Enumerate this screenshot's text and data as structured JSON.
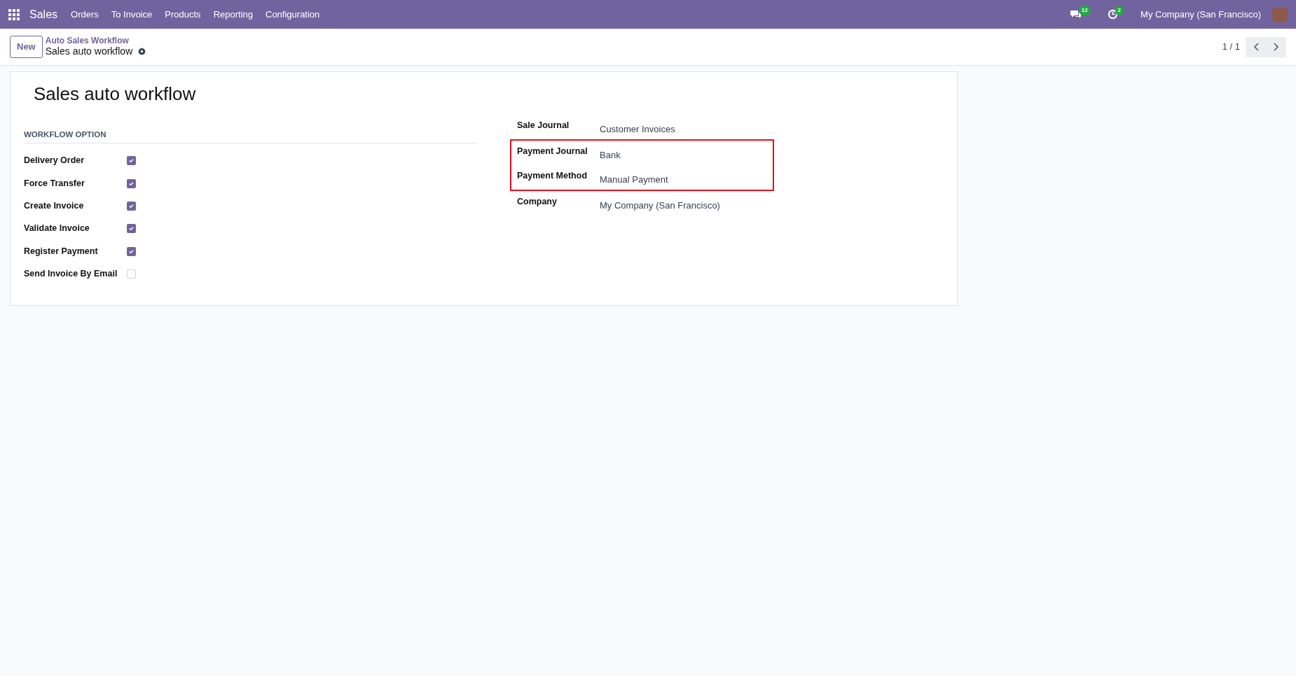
{
  "navbar": {
    "app": "Sales",
    "menu": [
      "Orders",
      "To Invoice",
      "Products",
      "Reporting",
      "Configuration"
    ],
    "messages_count": "12",
    "activities_count": "2",
    "company": "My Company (San Francisco)"
  },
  "control_panel": {
    "new_button": "New",
    "breadcrumb": "Auto Sales Workflow",
    "record": "Sales auto workflow",
    "pager": "1 / 1"
  },
  "form": {
    "title": "Sales auto workflow",
    "section": "WORKFLOW OPTION",
    "options": [
      {
        "label": "Delivery Order",
        "checked": true
      },
      {
        "label": "Force Transfer",
        "checked": true
      },
      {
        "label": "Create Invoice",
        "checked": true
      },
      {
        "label": "Validate Invoice",
        "checked": true
      },
      {
        "label": "Register Payment",
        "checked": true
      },
      {
        "label": "Send Invoice By Email",
        "checked": false
      }
    ],
    "fields": [
      {
        "label": "Sale Journal",
        "value": "Customer Invoices",
        "highlighted": false
      },
      {
        "label": "Payment Journal",
        "value": "Bank",
        "highlighted": true
      },
      {
        "label": "Payment Method",
        "value": "Manual Payment",
        "highlighted": true
      },
      {
        "label": "Company",
        "value": "My Company (San Francisco)",
        "highlighted": false
      }
    ]
  }
}
